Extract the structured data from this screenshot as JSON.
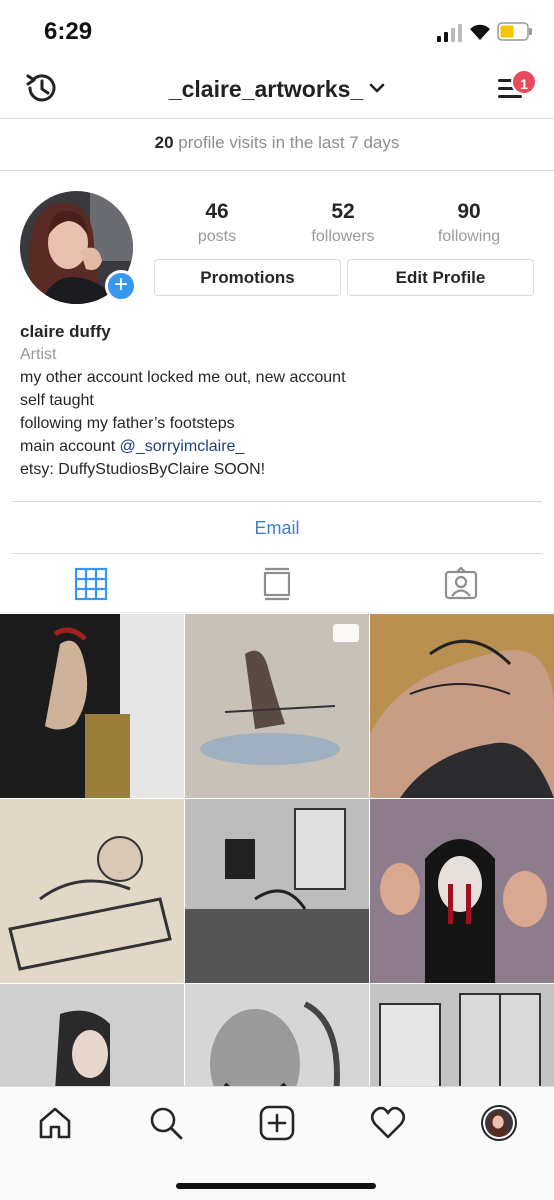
{
  "status_bar": {
    "time": "6:29"
  },
  "nav": {
    "username": "_claire_artworks_",
    "notification_count": "1"
  },
  "visits": {
    "count": "20",
    "text": " profile visits in the last 7 days"
  },
  "stats": [
    {
      "value": "46",
      "label": "posts"
    },
    {
      "value": "52",
      "label": "followers"
    },
    {
      "value": "90",
      "label": "following"
    }
  ],
  "buttons": {
    "promotions": "Promotions",
    "edit_profile": "Edit Profile"
  },
  "bio": {
    "name": "claire duffy",
    "category": "Artist",
    "line1": "my other account locked me out, new account",
    "line2": "self taught",
    "line3": "following my father’s footsteps",
    "line4_prefix": "main account ",
    "mention": "@_sorryimclaire_",
    "line5": "etsy: DuffyStudiosByClaire SOON!"
  },
  "contact": {
    "email": "Email"
  },
  "tabs": [
    "grid-icon",
    "feed-icon",
    "tagged-icon"
  ],
  "colors": {
    "accent": "#3897f0",
    "link": "#3f7fd0",
    "badge": "#e84a5a",
    "mention": "#1e3f7a"
  }
}
